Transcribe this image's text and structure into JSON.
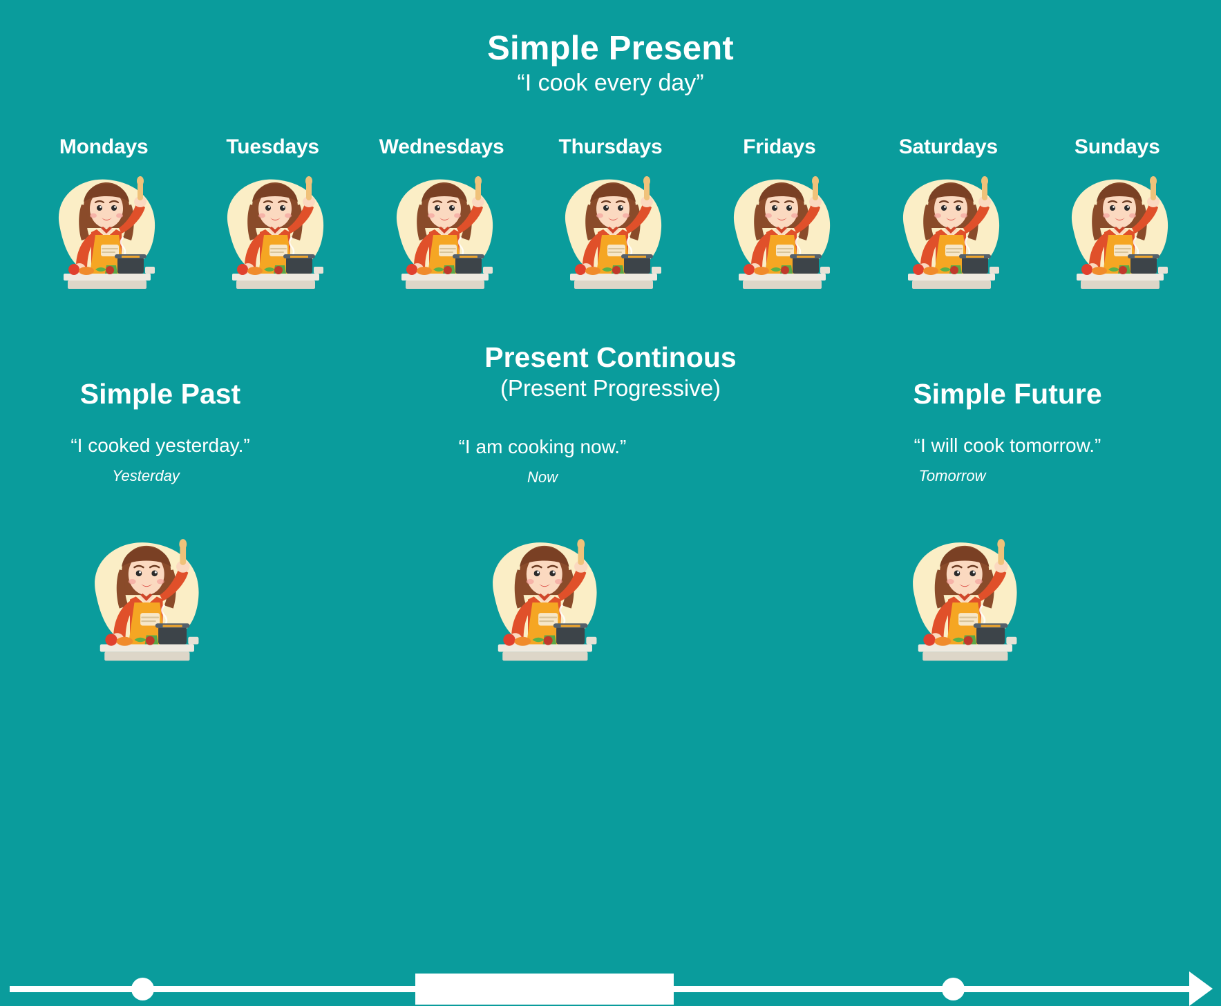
{
  "colors": {
    "background": "#0a9c9c",
    "text": "#ffffff",
    "blob": "#fbeec6",
    "hair": "#8a4b2a",
    "skin": "#fbd9c0",
    "shirt": "#e0502a",
    "shirt_dark": "#c8421f",
    "apron": "#f5a623",
    "pot": "#3d4449",
    "counter": "#efeae0",
    "tomato": "#e0402e",
    "carrot": "#f08b2c",
    "leaf": "#5bb04a",
    "spoon": "#f0c27a"
  },
  "header": {
    "main_title": "Simple Present",
    "sub_quote": "“I cook every day”"
  },
  "week": {
    "days": [
      {
        "label": "Mondays",
        "icon": "cooking-woman-illustration"
      },
      {
        "label": "Tuesdays",
        "icon": "cooking-woman-illustration"
      },
      {
        "label": "Wednesdays",
        "icon": "cooking-woman-illustration"
      },
      {
        "label": "Thursdays",
        "icon": "cooking-woman-illustration"
      },
      {
        "label": "Fridays",
        "icon": "cooking-woman-illustration"
      },
      {
        "label": "Saturdays",
        "icon": "cooking-woman-illustration"
      },
      {
        "label": "Sundays",
        "icon": "cooking-woman-illustration"
      }
    ]
  },
  "present_continuous": {
    "title": "Present Continous",
    "subtitle": "(Present Progressive)",
    "quote": "“I am cooking now.”",
    "marker": "Now"
  },
  "simple_past": {
    "title": "Simple Past",
    "quote": "“I cooked yesterday.”",
    "marker": "Yesterday"
  },
  "simple_future": {
    "title": "Simple Future",
    "quote": "“I will cook tomorrow.”",
    "marker": "Tomorrow"
  },
  "timeline": {
    "direction": "left-to-right",
    "arrow_icon": "arrow-right-icon",
    "past_marker_icon": "timeline-dot-icon",
    "now_marker_icon": "timeline-bar-icon",
    "future_marker_icon": "timeline-dot-icon"
  },
  "bottom_art": [
    {
      "icon": "cooking-woman-illustration",
      "tense": "simple-past"
    },
    {
      "icon": "cooking-woman-illustration",
      "tense": "present-continuous"
    },
    {
      "icon": "cooking-woman-illustration",
      "tense": "simple-future"
    }
  ]
}
